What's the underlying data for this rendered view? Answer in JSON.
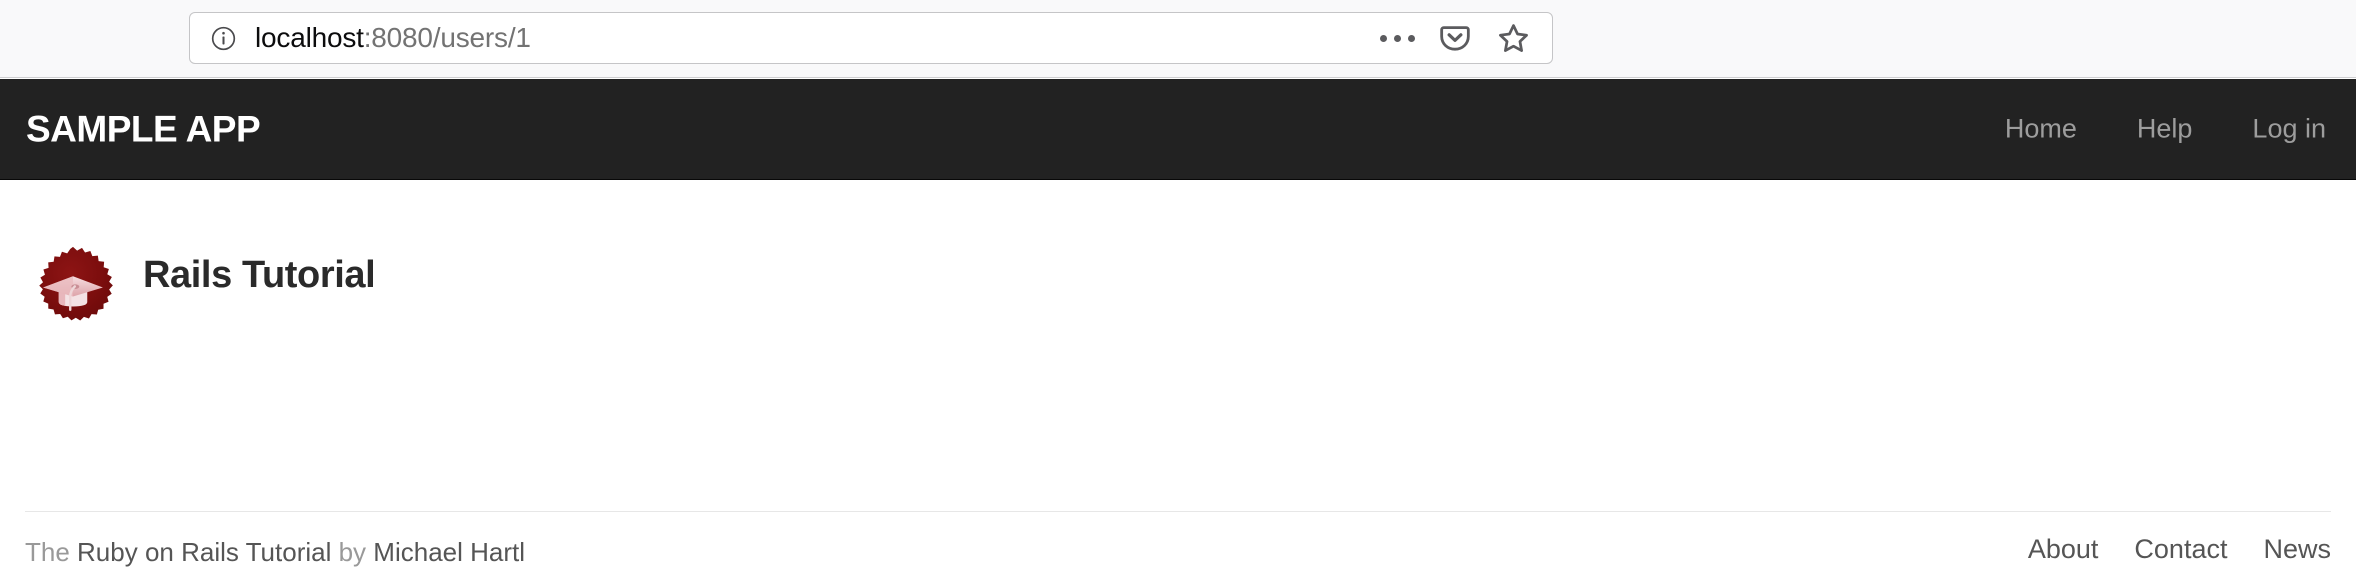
{
  "browser": {
    "url_host": "localhost",
    "url_rest": ":8080/users/1",
    "url_full": "localhost:8080/users/1",
    "icons": {
      "identity": "info-icon",
      "page_actions": "ellipsis-icon",
      "pocket": "pocket-icon",
      "bookmark": "star-icon"
    }
  },
  "navbar": {
    "brand": "SAMPLE APP",
    "links": [
      {
        "label": "Home"
      },
      {
        "label": "Help"
      },
      {
        "label": "Log in"
      }
    ],
    "background_color": "#222222",
    "link_color": "#9d9d9d"
  },
  "main": {
    "user": {
      "name": "Rails Tutorial",
      "avatar_alt": "gravatar",
      "avatar_badge_color": "#7d0e0e",
      "avatar_cap_color": "#f0c6c9"
    }
  },
  "footer": {
    "prefix": "The ",
    "tutorial_link": "Ruby on Rails Tutorial",
    "middle": " by ",
    "author_link": "Michael Hartl",
    "links": [
      {
        "label": "About"
      },
      {
        "label": "Contact"
      },
      {
        "label": "News"
      }
    ]
  }
}
